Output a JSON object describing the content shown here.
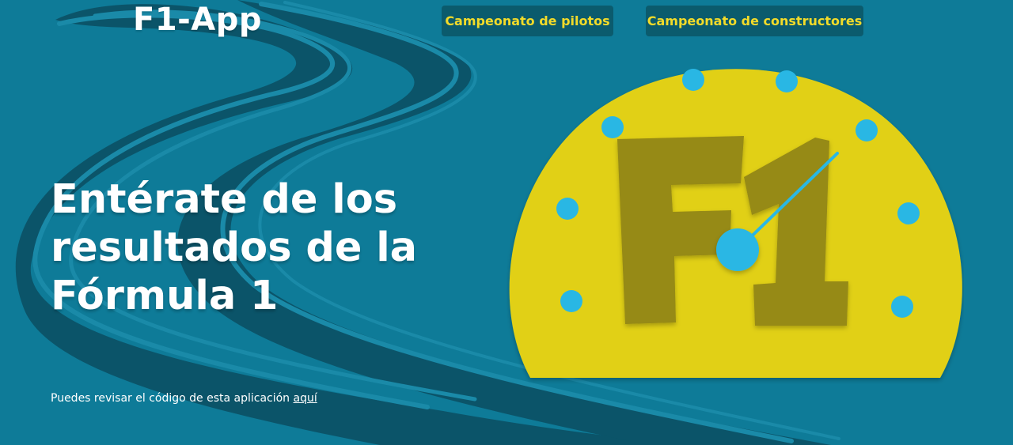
{
  "app": {
    "logo_text": "F1-App"
  },
  "nav": {
    "items": [
      {
        "label": "Campeonato de pilotos"
      },
      {
        "label": "Campeonato de constructores"
      }
    ]
  },
  "hero": {
    "title": "Entérate de los resultados de la Fórmula 1"
  },
  "footer": {
    "text": "Puedes revisar el código de esta aplicación",
    "link_label": "aquí"
  },
  "illustration": {
    "text": "F1"
  },
  "colors": {
    "background": "#0e7b98",
    "road_dark": "#0b5469",
    "nav_bg": "#0b5b6d",
    "accent_yellow": "#f3db29",
    "gauge_yellow": "#e1d015",
    "f1_olive": "#968a14",
    "dot_blue": "#29b7e4"
  }
}
